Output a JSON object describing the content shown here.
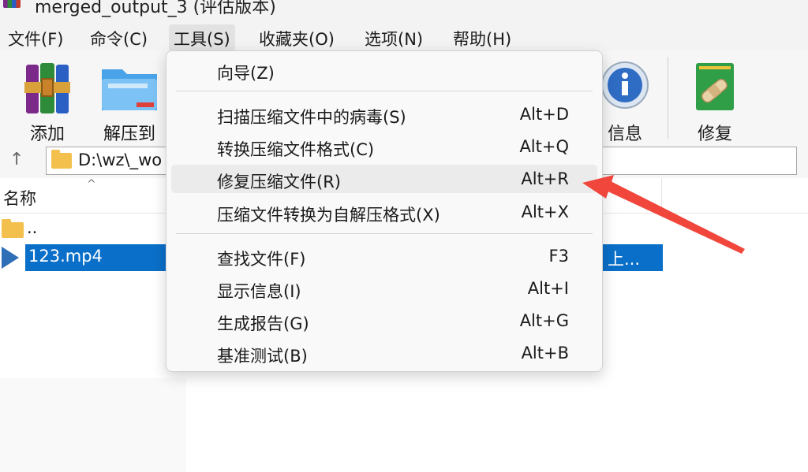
{
  "window": {
    "title": "merged_output_3 (评估版本)"
  },
  "menubar": {
    "items": [
      {
        "label": "文件(F)"
      },
      {
        "label": "命令(C)"
      },
      {
        "label": "工具(S)"
      },
      {
        "label": "收藏夹(O)"
      },
      {
        "label": "选项(N)"
      },
      {
        "label": "帮助(H)"
      }
    ]
  },
  "toolbar": {
    "add_label": "添加",
    "extract_label": "解压到",
    "info_label": "信息",
    "repair_label": "修复"
  },
  "addressbar": {
    "path": "D:\\wz\\_wo"
  },
  "list": {
    "header_name": "名称",
    "rows": [
      {
        "name": ".."
      },
      {
        "name": "123.mp4",
        "extra": "上..."
      }
    ]
  },
  "tools_menu": {
    "items": [
      {
        "label": "向导(Z)",
        "shortcut": ""
      },
      {
        "label": "扫描压缩文件中的病毒(S)",
        "shortcut": "Alt+D"
      },
      {
        "label": "转换压缩文件格式(C)",
        "shortcut": "Alt+Q"
      },
      {
        "label": "修复压缩文件(R)",
        "shortcut": "Alt+R"
      },
      {
        "label": "压缩文件转换为自解压格式(X)",
        "shortcut": "Alt+X"
      },
      {
        "label": "查找文件(F)",
        "shortcut": "F3"
      },
      {
        "label": "显示信息(I)",
        "shortcut": "Alt+I"
      },
      {
        "label": "生成报告(G)",
        "shortcut": "Alt+G"
      },
      {
        "label": "基准测试(B)",
        "shortcut": "Alt+B"
      }
    ]
  },
  "colors": {
    "selection": "#0a6fc9",
    "annotation_arrow": "#f0463c"
  }
}
